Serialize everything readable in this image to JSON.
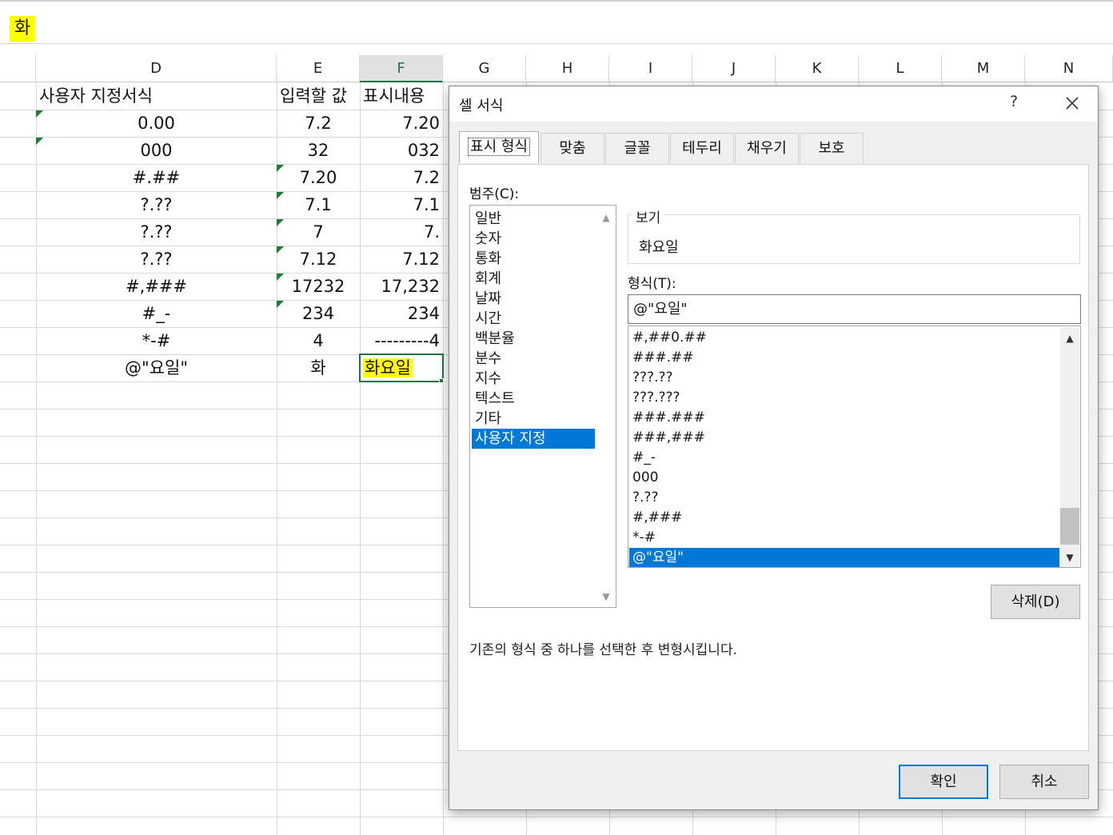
{
  "formula_bar": {
    "value": "화"
  },
  "columns": [
    "D",
    "E",
    "F",
    "G",
    "H",
    "I",
    "J",
    "K",
    "L",
    "M",
    "N"
  ],
  "sheet": {
    "rows": [
      {
        "d": "사용자 지정서식",
        "e": "입력할 값",
        "f": "표시내용"
      },
      {
        "d": "0.00",
        "e": "7.2",
        "f": "7.20"
      },
      {
        "d": "000",
        "e": "32",
        "f": "032"
      },
      {
        "d": "#.##",
        "e": "7.20",
        "f": "7.2"
      },
      {
        "d": "?.??",
        "e": "7.1",
        "f": "7.1"
      },
      {
        "d": "?.??",
        "e": "7",
        "f": "7."
      },
      {
        "d": "?.??",
        "e": "7.12",
        "f": "7.12"
      },
      {
        "d": "#,###",
        "e": "17232",
        "f": "17,232"
      },
      {
        "d": "#_-",
        "e": "234",
        "f": "234"
      },
      {
        "d": "*-#",
        "e": "4",
        "f": "---------4"
      },
      {
        "d": "@\"요일\"",
        "e": "화",
        "f": "화요일"
      }
    ]
  },
  "dialog": {
    "title": "셀 서식",
    "help": "?",
    "tabs": [
      "표시 형식",
      "맞춤",
      "글꼴",
      "테두리",
      "채우기",
      "보호"
    ],
    "category_label": "범주(C):",
    "categories": [
      "일반",
      "숫자",
      "통화",
      "회계",
      "날짜",
      "시간",
      "백분율",
      "분수",
      "지수",
      "텍스트",
      "기타",
      "사용자 지정"
    ],
    "sample_label": "보기",
    "sample_value": "화요일",
    "type_label": "형식(T):",
    "type_value": "@\"요일\"",
    "formats": [
      "#,##0.##",
      "###.##",
      "???.??",
      "???.???",
      "###.###",
      "###,###",
      "#_-",
      "000",
      "?.??",
      "#,###",
      "*-#",
      "@\"요일\""
    ],
    "delete_label": "삭제(D)",
    "description": "기존의 형식 중 하나를 선택한 후 변형시킵니다.",
    "ok_label": "확인",
    "cancel_label": "취소"
  },
  "colors": {
    "accent": "#0078d7",
    "excel_green": "#217346",
    "highlight": "#ffff00"
  }
}
